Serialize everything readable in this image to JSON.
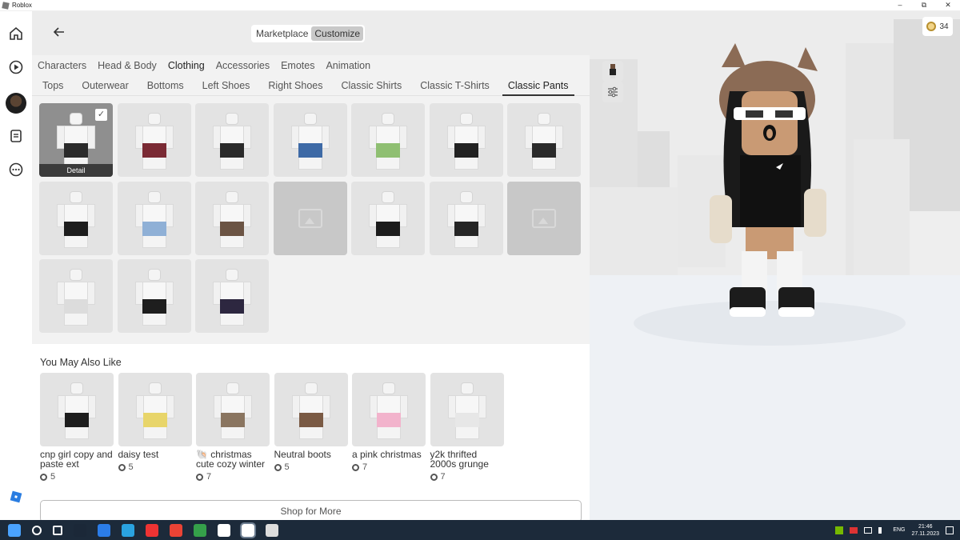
{
  "window": {
    "title": "Roblox",
    "controls": [
      "–",
      "⧉",
      "✕"
    ]
  },
  "rail": {
    "icons": [
      "home-icon",
      "play-icon",
      "avatar",
      "chat-icon",
      "more-icon"
    ]
  },
  "header": {
    "segments": [
      "Marketplace",
      "Customize"
    ],
    "active_segment": "Customize"
  },
  "category_tabs": [
    "Characters",
    "Head & Body",
    "Clothing",
    "Accessories",
    "Emotes",
    "Animation"
  ],
  "active_category": "Clothing",
  "sub_tabs": [
    "Tops",
    "Outerwear",
    "Bottoms",
    "Left Shoes",
    "Right Shoes",
    "Classic Shirts",
    "Classic T-Shirts",
    "Classic Pants"
  ],
  "active_sub_tab": "Classic Pants",
  "grid": {
    "detail_label": "Detail",
    "items": [
      {
        "pants": "#2b2b2b",
        "selected": true
      },
      {
        "pants": "#7a2a34"
      },
      {
        "pants": "#2a2a2a"
      },
      {
        "pants": "#3e6aa6"
      },
      {
        "pants": "#8fbf72"
      },
      {
        "pants": "#222222"
      },
      {
        "pants": "#2a2a2a"
      },
      {
        "pants": "#1d1d1d"
      },
      {
        "pants": "#8fb0d6"
      },
      {
        "pants": "#6b5444"
      },
      {
        "placeholder": true
      },
      {
        "pants": "#1c1c1c"
      },
      {
        "pants": "#262626"
      },
      {
        "placeholder": true
      },
      {
        "pants": "#dcdcdc"
      },
      {
        "pants": "#1e1e1e"
      },
      {
        "pants": "#2d2740"
      }
    ]
  },
  "recommendations": {
    "title": "You May Also Like",
    "items": [
      {
        "name": "cnp girl copy and paste ext",
        "price": "5",
        "pants": "#1e1e1e"
      },
      {
        "name": "daisy test",
        "price": "5",
        "pants": "#e8d56a"
      },
      {
        "name": "🐚 christmas cute cozy winter",
        "price": "7",
        "pants": "#8a7560"
      },
      {
        "name": "Neutral boots",
        "price": "5",
        "pants": "#7a5a44"
      },
      {
        "name": "a pink christmas",
        "price": "7",
        "pants": "#f2b3cc"
      },
      {
        "name": "y2k thrifted 2000s grunge",
        "price": "7",
        "pants": "#e7e7e7"
      }
    ],
    "shop_button": "Shop for More"
  },
  "scene": {
    "robux_balance": "34"
  },
  "taskbar": {
    "language": "ENG",
    "time": "21:46",
    "date": "27.11.2023",
    "apps": [
      "windows-start-icon",
      "search-icon",
      "task-view-icon",
      "steam-icon",
      "file-manager-icon",
      "telegram-icon",
      "anydesk-icon",
      "chrome-icon",
      "xbox-icon",
      "notepad-icon",
      "roblox-icon",
      "roblox-studio-icon"
    ]
  }
}
